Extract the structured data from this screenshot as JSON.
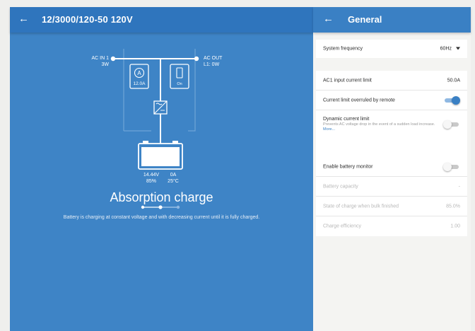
{
  "left": {
    "title": "12/3000/120-50 120V",
    "back_icon": "arrow-left-icon",
    "ac_in_label": "AC IN 1",
    "ac_in_value": "3W",
    "ac_out_label": "AC OUT",
    "ac_out_value": "L1: 0W",
    "current_limit_value": "12.0A",
    "switch_label": "On",
    "battery_voltage": "14.44V",
    "battery_current": "0A",
    "battery_soc": "85%",
    "battery_temp": "25°C",
    "charge_state": "Absorption charge",
    "charge_description": "Battery is charging at constant voltage and with decreasing current until it is fully charged.",
    "charge_stage_index": 1,
    "charge_stage_count": 3
  },
  "right": {
    "title": "General",
    "back_icon": "arrow-left-icon",
    "system_frequency_label": "System frequency",
    "system_frequency_value": "60Hz",
    "ac1_limit_label": "AC1 input current limit",
    "ac1_limit_value": "50.0A",
    "overruled_label": "Current limit overruled by remote",
    "overruled_on": true,
    "dynamic_title": "Dynamic current limit",
    "dynamic_desc": "Prevents AC voltage drop in the event of a sudden load increase.",
    "dynamic_more": "More...",
    "dynamic_on": false,
    "battery_monitor_label": "Enable battery monitor",
    "battery_monitor_on": false,
    "battery_capacity_label": "Battery capacity",
    "battery_capacity_value": "-",
    "soc_bulk_label": "State of charge when bulk finished",
    "soc_bulk_value": "85.0%",
    "charge_eff_label": "Charge efficiency",
    "charge_eff_value": "1.00"
  },
  "colors": {
    "panel_blue": "#3e84c6",
    "header_blue": "#2f75bd",
    "accent": "#3a80c4"
  }
}
